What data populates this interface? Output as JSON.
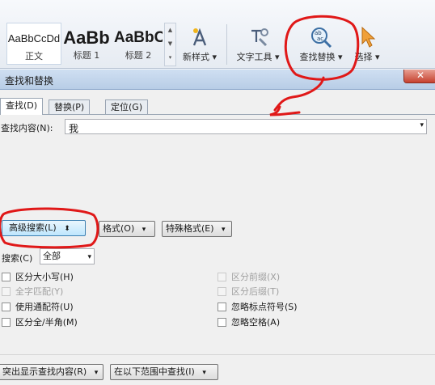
{
  "ribbon": {
    "styles": [
      {
        "preview": "AaBbCcDd",
        "name": "正文"
      },
      {
        "preview": "AaBb",
        "name": "标题 1"
      },
      {
        "preview": "AaBbC",
        "name": "标题 2"
      }
    ],
    "buttons": {
      "new_style": "新样式 ▾",
      "text_tools": "文字工具 ▾",
      "find_replace": "查找替换 ▾",
      "select": "选择 ▾"
    },
    "gallery_scroll": [
      "▲",
      "▼",
      "▾"
    ]
  },
  "dialog": {
    "title": "查找和替换",
    "close": "✕",
    "tabs": [
      {
        "label": "查找(D)",
        "active": true
      },
      {
        "label": "替换(P)",
        "active": false
      },
      {
        "label": "定位(G)",
        "active": false
      }
    ],
    "find_label": "查找内容(N):",
    "find_value": "我",
    "advanced_button": "高级搜索(L)",
    "advanced_arrow": "⬍",
    "format_button": "格式(O)",
    "special_button": "特殊格式(E)",
    "search_label": "搜索(C)",
    "search_value": "全部",
    "options_left": [
      {
        "label": "区分大小写(H)",
        "enabled": true
      },
      {
        "label": "全字匹配(Y)",
        "enabled": false
      },
      {
        "label": "使用通配符(U)",
        "enabled": true
      },
      {
        "label": "区分全/半角(M)",
        "enabled": true
      }
    ],
    "options_right": [
      {
        "label": "区分前缀(X)",
        "enabled": false
      },
      {
        "label": "区分后缀(T)",
        "enabled": false
      },
      {
        "label": "忽略标点符号(S)",
        "enabled": true
      },
      {
        "label": "忽略空格(A)",
        "enabled": true
      }
    ],
    "highlight_button": "突出显示查找内容(R)",
    "find_in_button": "在以下范围中查找(I)",
    "dropdown_arrow": "▾"
  },
  "colors": {
    "annotation": "#e01818",
    "accent": "#3c7fb1"
  }
}
